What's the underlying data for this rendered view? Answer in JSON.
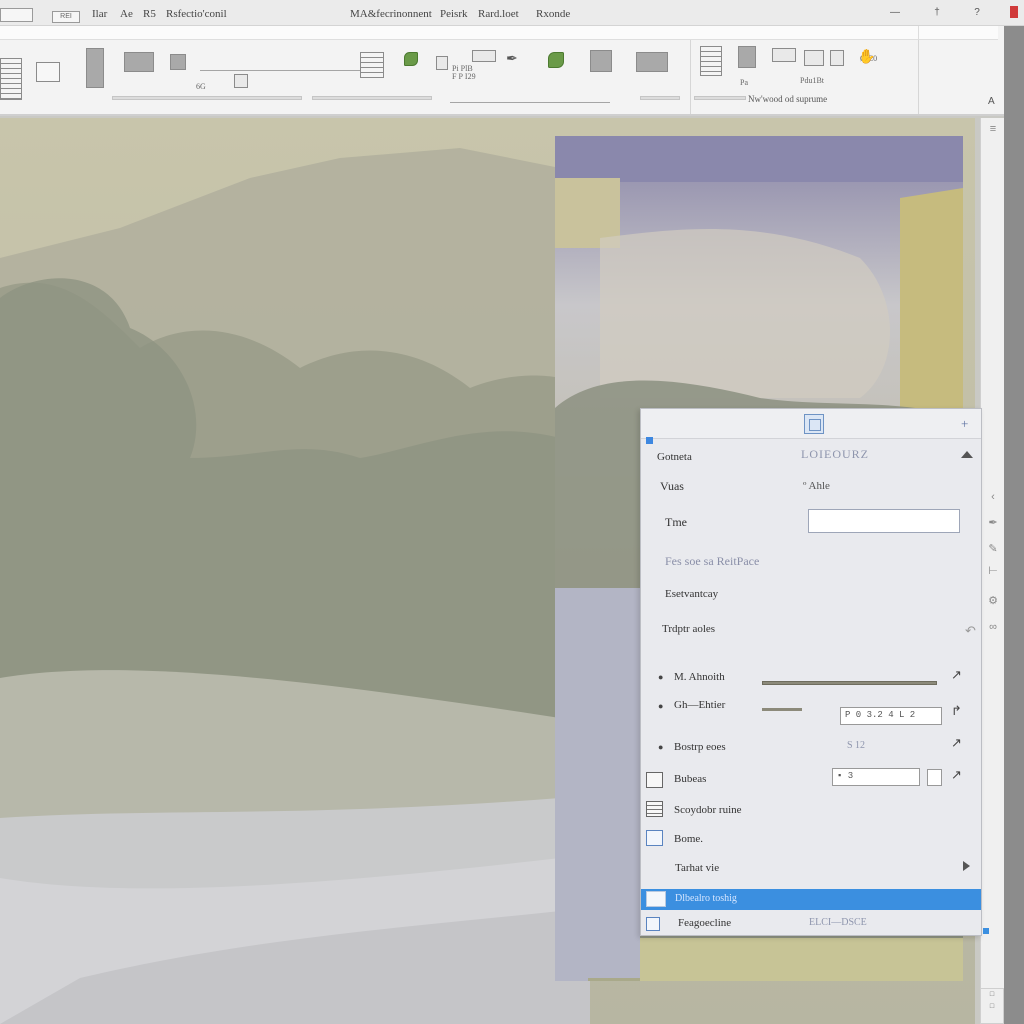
{
  "titlebar": {
    "doc_label": "REI",
    "items": [
      "Ilar",
      "Ae",
      "R5",
      "Rsfectio'conil"
    ],
    "center_items": [
      "MA&fecrinonnent",
      "Peisrk",
      "Rard.loet",
      "Rxonde"
    ],
    "ctl_min": "—",
    "ctl_max": "†",
    "ctl_help": "?"
  },
  "ribbon": {
    "labels": {
      "a": "6G",
      "b": "Pi PlB",
      "c": "F P I29",
      "d": "Pa",
      "e": "Ø C0",
      "f": "Pdu1Bt"
    },
    "bottom_caption": "Nw'wood od suprume",
    "corner_glyph": "A"
  },
  "panel": {
    "header_close": "+",
    "rows": [
      {
        "label": "Gotneta",
        "value": "LOIEOURZ"
      },
      {
        "label": "Vuas",
        "value": "º Ahle"
      },
      {
        "label": "Tme",
        "value": ""
      },
      {
        "label": "Fes soe sa ReitPace",
        "value": ""
      },
      {
        "label": "Esetvantcay",
        "value": ""
      },
      {
        "label": "Trdptr aoles",
        "value": ""
      }
    ],
    "controls": [
      {
        "label": "M. Ahnoith",
        "box": "",
        "arrow": "↗"
      },
      {
        "label": "Gh—Ehtier",
        "box": "P 0 3.2 4 L 2",
        "arrow": "↱"
      },
      {
        "label": "Bostrp eoes",
        "box": "S 12",
        "arrow": "↗"
      },
      {
        "label": "Bubeas",
        "box": "▪ 3",
        "arrow": "↗"
      }
    ],
    "items": [
      {
        "label": "Scoydobr ruine"
      },
      {
        "label": "Bome."
      },
      {
        "label": "Tarhat vie"
      }
    ],
    "selected_label": "Dlbealro  toshig",
    "last_row_label": "Feagoecline",
    "last_row_value": "ELCI—DSCE"
  },
  "colors": {
    "accent": "#3b8fe0",
    "canvas_bg": "#bdbba6",
    "panel_bg": "#e9eaee"
  }
}
